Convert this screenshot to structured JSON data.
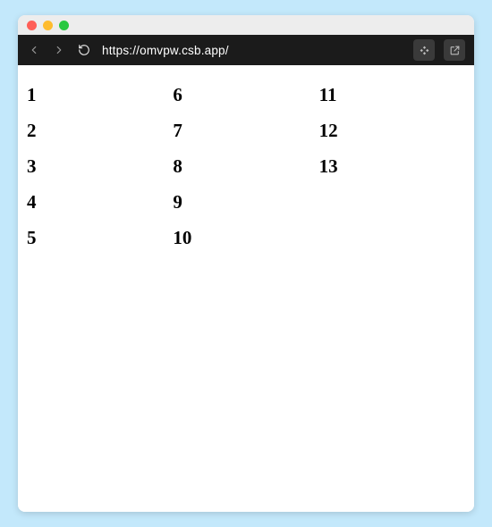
{
  "browser": {
    "url": "https://omvpw.csb.app/"
  },
  "list": {
    "items": [
      "1",
      "2",
      "3",
      "4",
      "5",
      "6",
      "7",
      "8",
      "9",
      "10",
      "11",
      "12",
      "13"
    ]
  }
}
